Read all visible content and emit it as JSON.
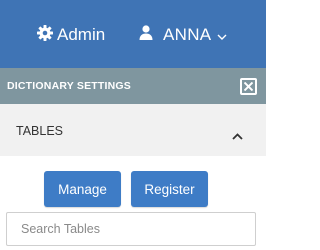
{
  "header": {
    "admin_label": "Admin",
    "admin_icon": "gear-icon",
    "user_label": "ANNA",
    "user_icon": "user-icon",
    "user_menu_icon": "chevron-down-icon",
    "background": "#3f74b5"
  },
  "dictionary_settings": {
    "title": "DICTIONARY SETTINGS",
    "close_icon": "close-box-icon",
    "background": "#7f969f"
  },
  "tables_section": {
    "title": "TABLES",
    "toggle_icon": "chevron-up-icon",
    "buttons": {
      "manage_label": "Manage",
      "register_label": "Register",
      "button_color": "#3e7cc6"
    },
    "search": {
      "placeholder": "Search Tables",
      "value": ""
    }
  }
}
